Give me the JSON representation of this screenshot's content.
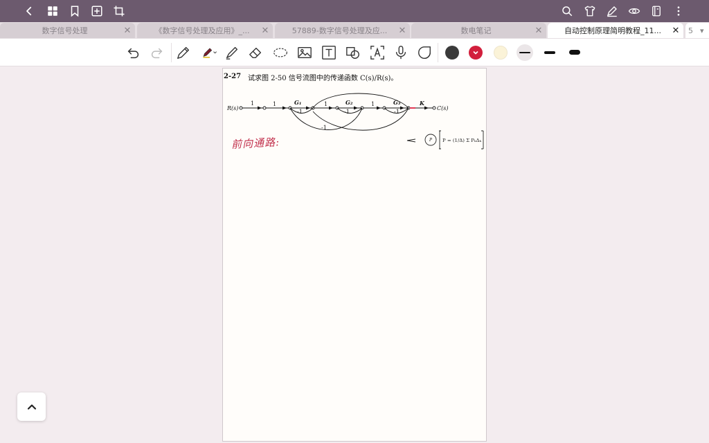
{
  "tabs": [
    {
      "title": "数字信号处理",
      "close": "✕"
    },
    {
      "title": "《数字信号处理及应用》_...",
      "close": "✕"
    },
    {
      "title": "57889-数字信号处理及应...",
      "close": "✕"
    },
    {
      "title": "数电笔记",
      "close": "✕"
    },
    {
      "title": "自动控制原理简明教程_11...",
      "close": "✕"
    }
  ],
  "tab_count": "5",
  "tab_more_icon": "▾",
  "colors": {
    "topbar": "#6c5a6e",
    "swatch_dark": "#3a3a3a",
    "swatch_red": "#d21f3c",
    "swatch_cream": "#fbf3d8",
    "annotation_red": "#c2314d"
  },
  "document": {
    "problem_number": "2-27",
    "problem_text": "试求图 2-50 信号流图中的传递函数 C(s)/R(s)。",
    "diagram": {
      "input": "R(s)",
      "output": "C(s)",
      "gains": {
        "g1": "G₁",
        "g2": "G₂",
        "g3": "G₃",
        "k": "K"
      },
      "branch_ones": [
        "1",
        "1",
        "1",
        "1"
      ],
      "feedback_labels": [
        "-1",
        "-1",
        "-1",
        "-1"
      ]
    },
    "annotation_prefix": "前向通路:",
    "annotation_formula": "P = (1/Δ) Σ PₖΔₖ"
  }
}
